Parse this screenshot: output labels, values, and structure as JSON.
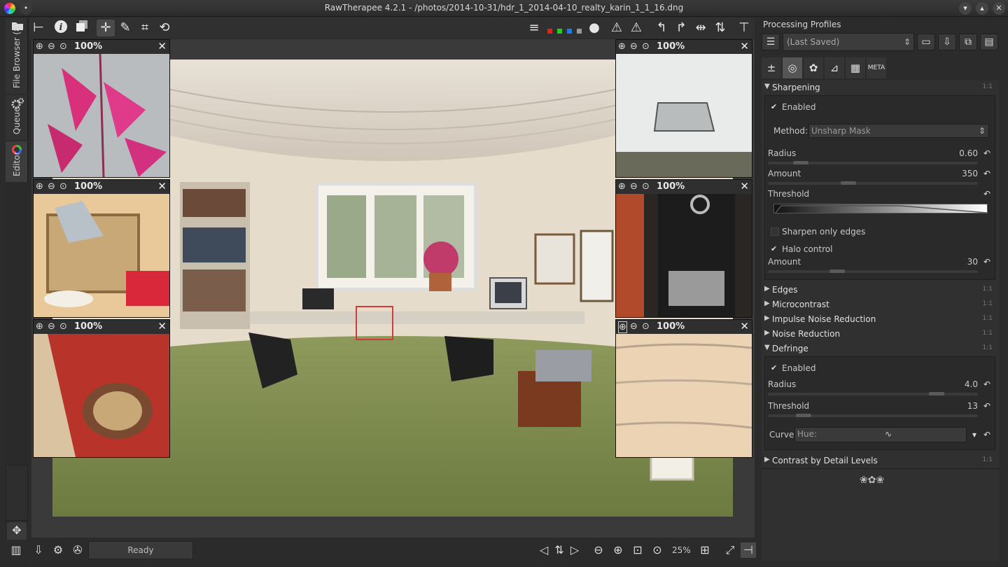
{
  "window": {
    "title": "RawTherapee 4.2.1 - /photos/2014-10-31/hdr_1_2014-04-10_realty_karin_1_1_16.dng",
    "minimize": "▾",
    "close": "✕"
  },
  "side_tabs": {
    "file_browser": "File Browser (8)",
    "queue": "Queue",
    "editor": "Editor"
  },
  "detail_windows": [
    {
      "zoom": "100%",
      "close": "✕"
    },
    {
      "zoom": "100%",
      "close": "✕"
    },
    {
      "zoom": "100%",
      "close": "✕"
    },
    {
      "zoom": "100%",
      "close": "✕"
    },
    {
      "zoom": "100%",
      "close": "✕"
    },
    {
      "zoom": "100%",
      "close": "✕"
    }
  ],
  "status": {
    "ready": "Ready",
    "zoom": "25%"
  },
  "right_panel": {
    "processing_profiles_title": "Processing Profiles",
    "profile_value": "(Last Saved)",
    "sections": {
      "sharpening": {
        "name": "Sharpening",
        "enabled_label": "Enabled",
        "method_label": "Method:",
        "method_value": "Unsharp Mask",
        "radius_label": "Radius",
        "radius_value": "0.60",
        "amount_label": "Amount",
        "amount_value": "350",
        "threshold_label": "Threshold",
        "only_edges_label": "Sharpen only edges",
        "halo_label": "Halo control",
        "halo_amount_label": "Amount",
        "halo_amount_value": "30"
      },
      "edges": "Edges",
      "microcontrast": "Microcontrast",
      "impulse": "Impulse Noise Reduction",
      "noise": "Noise Reduction",
      "defringe": {
        "name": "Defringe",
        "enabled_label": "Enabled",
        "radius_label": "Radius",
        "radius_value": "4.0",
        "threshold_label": "Threshold",
        "threshold_value": "13",
        "curve_label": "Curve:",
        "curve_value": "Hue:"
      },
      "cbdl": "Contrast by Detail Levels"
    },
    "one_to_one": "1:1"
  },
  "colors": {
    "accent_red": "#d33a3a",
    "panel_bg": "#2b2b2b"
  }
}
